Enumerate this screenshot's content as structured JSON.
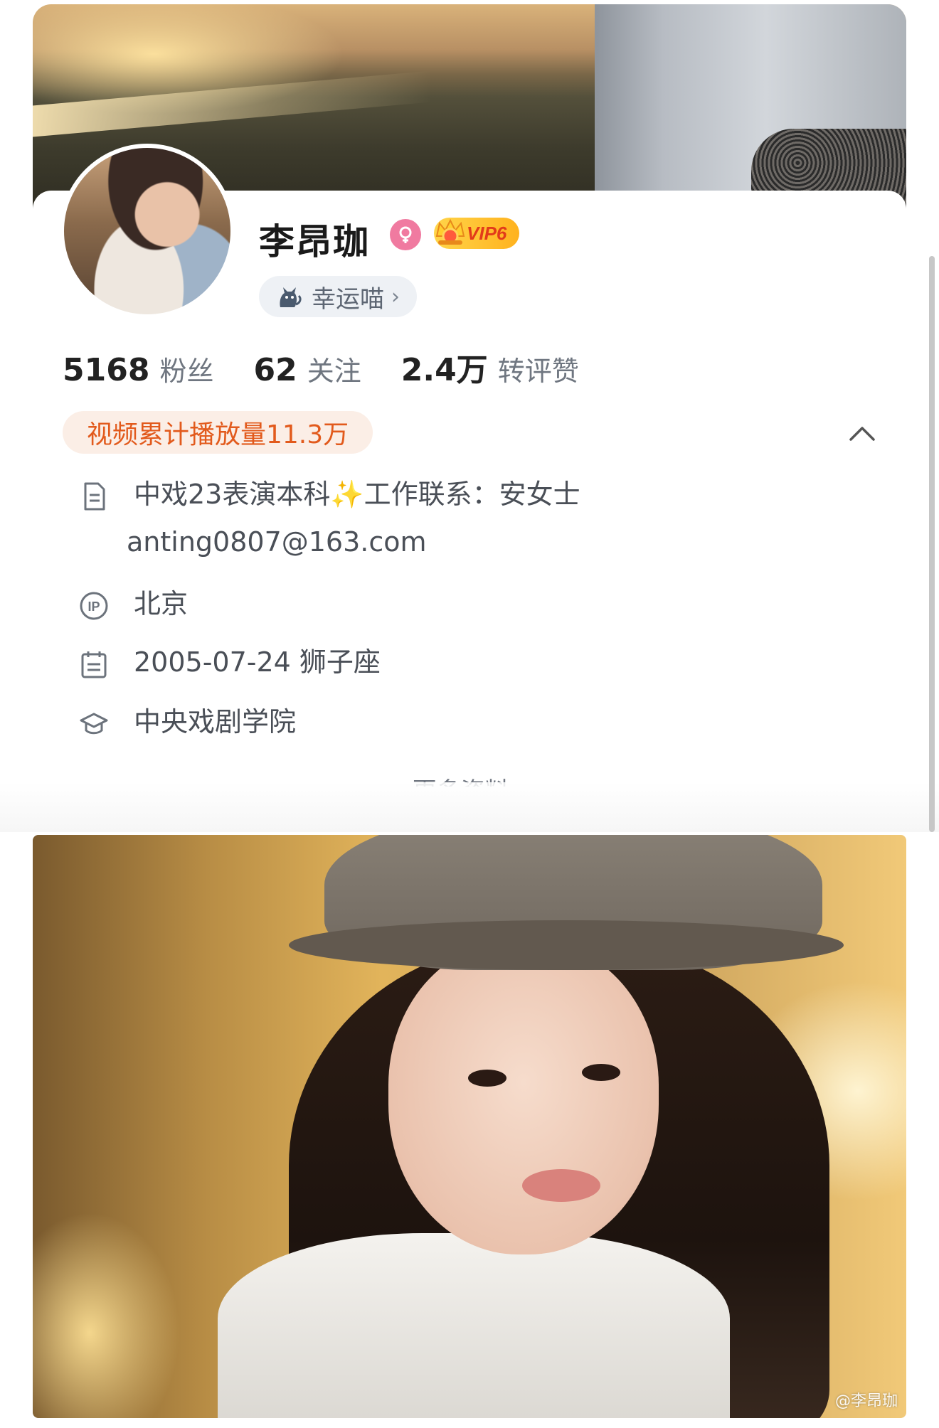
{
  "profile": {
    "name": "李昂珈",
    "vip_label": "VIP6",
    "lucky_chip": "幸运喵",
    "lucky_chevron": "›"
  },
  "stats": [
    {
      "value": "5168",
      "label": "粉丝"
    },
    {
      "value": "62",
      "label": "关注"
    },
    {
      "value": "2.4万",
      "label": "转评赞"
    }
  ],
  "play_badge": "视频累计播放量11.3万",
  "info": {
    "bio_line1": "中戏23表演本科✨工作联系：安女士",
    "bio_line2": "anting0807@163.com",
    "ip_location": "北京",
    "birthday": "2005-07-24 狮子座",
    "school": "中央戏剧学院"
  },
  "more_link": "更多资料 ›",
  "watermark": "@李昂珈",
  "colors": {
    "accent_orange": "#e25a1c",
    "badge_bg": "#fbeee6",
    "gender_pink": "#f07aa0",
    "vip_gold": "#ffc233"
  },
  "icons": {
    "gender": "female-icon",
    "vip": "crown-icon",
    "lucky": "cat-icon",
    "collapse": "chevron-up-icon",
    "bio": "document-icon",
    "ip": "ip-icon",
    "birthday": "calendar-icon",
    "school": "graduation-cap-icon"
  }
}
